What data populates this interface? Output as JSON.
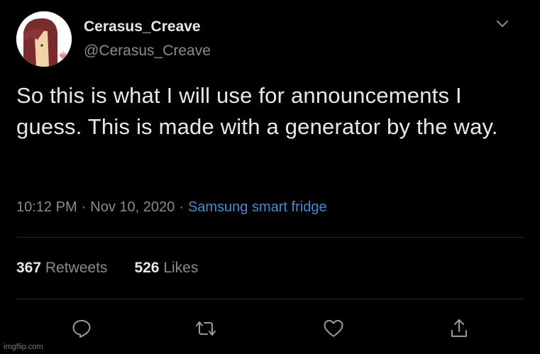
{
  "user": {
    "display_name": "Cerasus_Creave",
    "handle": "@Cerasus_Creave",
    "avatar_icon": "avatar"
  },
  "tweet": {
    "text": "So this is what I will use for announcements I guess. This is made with a generator by the way.",
    "time": "10:12 PM",
    "separator": "·",
    "date": "Nov 10, 2020",
    "source": "Samsung smart fridge"
  },
  "stats": {
    "retweets_count": "367",
    "retweets_label": "Retweets",
    "likes_count": "526",
    "likes_label": "Likes"
  },
  "actions": [
    "reply-icon",
    "retweet-icon",
    "like-icon",
    "share-icon"
  ],
  "watermark": "imgflip.com",
  "colors": {
    "background": "#000000",
    "text": "#e8e8e8",
    "secondary": "#8b8b8b",
    "link": "#3d8fd6",
    "divider": "#2a2a2a"
  }
}
